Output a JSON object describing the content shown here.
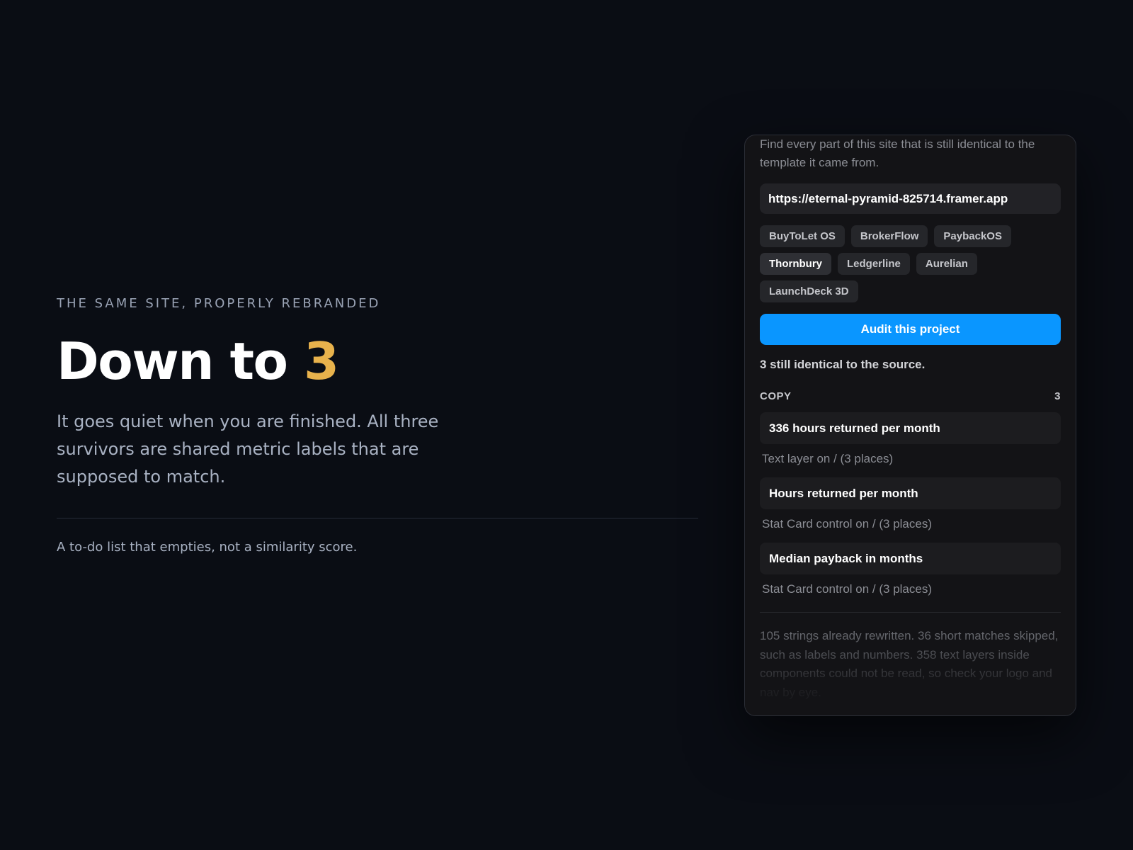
{
  "hero": {
    "eyebrow": "THE SAME SITE, PROPERLY REBRANDED",
    "headline_prefix": "Down to",
    "headline_count": "3",
    "lede": "It goes quiet when you are finished. All three survivors are shared metric labels that are supposed to match.",
    "footnote": "A to-do list that empties, not a similarity score."
  },
  "panel": {
    "intro": "Find every part of this site that is still identical to the template it came from.",
    "url": "https://eternal-pyramid-825714.framer.app",
    "projects": [
      {
        "label": "BuyToLet OS",
        "active": false
      },
      {
        "label": "BrokerFlow",
        "active": false
      },
      {
        "label": "PaybackOS",
        "active": false
      },
      {
        "label": "Thornbury",
        "active": true
      },
      {
        "label": "Ledgerline",
        "active": false
      },
      {
        "label": "Aurelian",
        "active": false
      },
      {
        "label": "LaunchDeck 3D",
        "active": false
      }
    ],
    "audit_button": "Audit this project",
    "summary": "3 still identical to the source.",
    "section": {
      "title": "COPY",
      "count": "3"
    },
    "matches": [
      {
        "title": "336 hours returned per month",
        "detail": "Text layer on / (3 places)"
      },
      {
        "title": "Hours returned per month",
        "detail": "Stat Card control on / (3 places)"
      },
      {
        "title": "Median payback in months",
        "detail": "Stat Card control on / (3 places)"
      }
    ],
    "notes": "105 strings already rewritten. 36 short matches skipped, such as labels and numbers. 358 text layers inside components could not be read, so check your logo and nav by eye."
  },
  "colors": {
    "background": "#0a0d14",
    "accent": "#e8b24c",
    "button": "#0a96ff"
  }
}
